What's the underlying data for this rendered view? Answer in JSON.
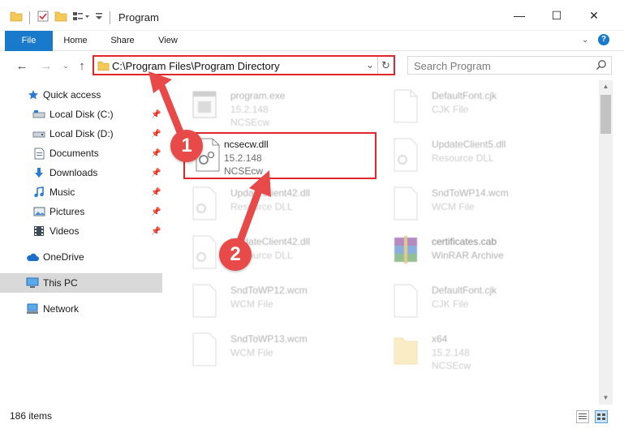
{
  "window": {
    "title": "Program",
    "minimize": "—",
    "maximize": "☐",
    "close": "✕"
  },
  "ribbon": {
    "tabs": [
      "File",
      "Home",
      "Share",
      "View"
    ],
    "help": "?"
  },
  "address": {
    "path": "C:\\Program Files\\Program Directory",
    "search_placeholder": "Search Program"
  },
  "nav": {
    "items": [
      {
        "label": "Quick access",
        "icon": "star-icon",
        "pinned": false
      },
      {
        "label": "Local Disk (C:)",
        "icon": "drive-icon",
        "pinned": true
      },
      {
        "label": "Local Disk (D:)",
        "icon": "drive-icon",
        "pinned": true
      },
      {
        "label": "Documents",
        "icon": "documents-icon",
        "pinned": true
      },
      {
        "label": "Downloads",
        "icon": "download-icon",
        "pinned": true
      },
      {
        "label": "Music",
        "icon": "music-icon",
        "pinned": true
      },
      {
        "label": "Pictures",
        "icon": "pictures-icon",
        "pinned": true
      },
      {
        "label": "Videos",
        "icon": "videos-icon",
        "pinned": true
      },
      {
        "label": "OneDrive",
        "icon": "cloud-icon",
        "pinned": false
      },
      {
        "label": "This PC",
        "icon": "computer-icon",
        "pinned": false,
        "selected": true
      },
      {
        "label": "Network",
        "icon": "network-icon",
        "pinned": false
      }
    ]
  },
  "files": [
    {
      "name": "program.exe",
      "line2": "15.2.148",
      "line3": "NCSEcw",
      "type": "exe",
      "faded": true
    },
    {
      "name": "DefaultFont.cjk",
      "line2": "CJK File",
      "line3": "",
      "type": "doc",
      "faded": true
    },
    {
      "name": "ncsecw.dll",
      "line2": "15.2.148",
      "line3": "NCSEcw",
      "type": "dll",
      "faded": false,
      "highlighted": true
    },
    {
      "name": "UpdateClient5.dll",
      "line2": "Resource DLL",
      "line3": "",
      "type": "dll",
      "faded": true
    },
    {
      "name": "UpdateClient42.dll",
      "line2": "Resource DLL",
      "line3": "",
      "type": "dll",
      "faded": true
    },
    {
      "name": "SndToWP14.wcm",
      "line2": "WCM File",
      "line3": "",
      "type": "doc",
      "faded": true
    },
    {
      "name": "UpdateClient42.dll",
      "line2": "Resource DLL",
      "line3": "",
      "type": "dll",
      "faded": true
    },
    {
      "name": "certificates.cab",
      "line2": "WinRAR Archive",
      "line3": "",
      "type": "rar",
      "faded": true
    },
    {
      "name": "SndToWP12.wcm",
      "line2": "WCM File",
      "line3": "",
      "type": "doc",
      "faded": true
    },
    {
      "name": "DefaultFont.cjk",
      "line2": "CJK File",
      "line3": "",
      "type": "doc",
      "faded": true
    },
    {
      "name": "SndToWP13.wcm",
      "line2": "WCM File",
      "line3": "",
      "type": "doc",
      "faded": true
    },
    {
      "name": "x64",
      "line2": "15.2.148",
      "line3": "NCSEcw",
      "type": "folder",
      "faded": true
    }
  ],
  "status": {
    "count": "186 items"
  },
  "annotations": [
    "1",
    "2"
  ],
  "colors": {
    "accent": "#1979ca",
    "highlight": "#e0272b",
    "badge": "#e84a4a"
  }
}
